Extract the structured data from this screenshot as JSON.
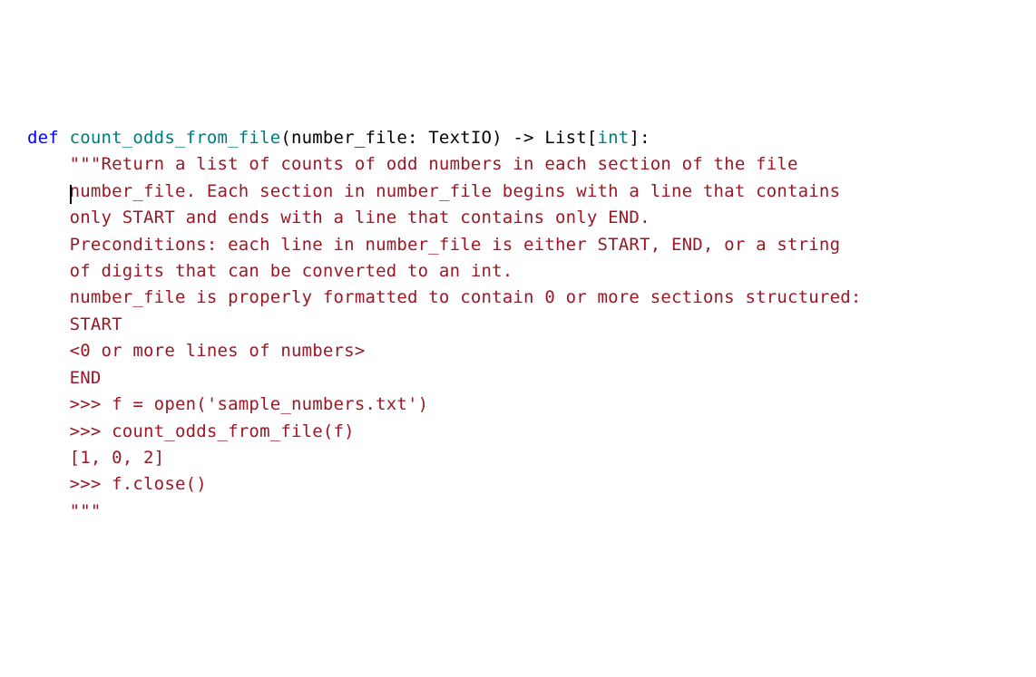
{
  "code": {
    "l0_def": "def ",
    "l0_fn": "count_odds_from_file",
    "l0_open": "(number_file: TextIO) -> List[",
    "l0_int": "int",
    "l0_close": "]:",
    "indent": "    ",
    "d1": "\"\"\"Return a list of counts of odd numbers in each section of the file",
    "d2a": "number_file. Each section in number_file begins with a line that contains",
    "d3": "only START and ends with a line that contains only END.",
    "d4": "",
    "d5": "Preconditions: each line in number_file is either START, END, or a string",
    "d6": "of digits that can be converted to an int.",
    "d7": "number_file is properly formatted to contain 0 or more sections structured:",
    "d8": "START",
    "d9": "<0 or more lines of numbers>",
    "d10": "END",
    "d11": "",
    "d12": ">>> f = open('sample_numbers.txt')",
    "d13": ">>> count_odds_from_file(f)",
    "d14": "[1, 0, 2]",
    "d15": ">>> f.close()",
    "d16": "\"\"\""
  }
}
